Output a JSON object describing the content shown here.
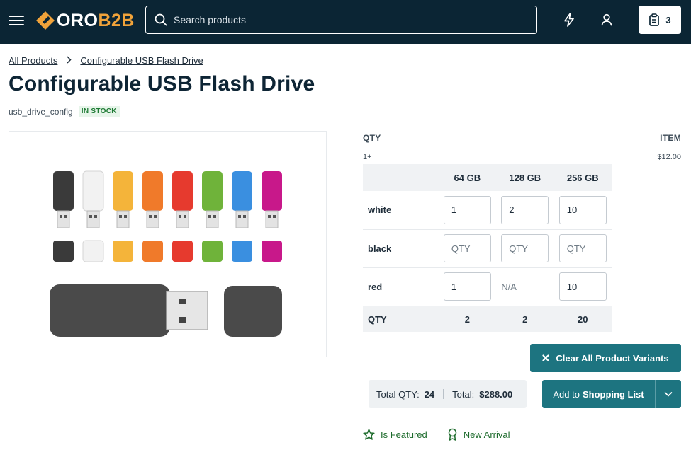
{
  "header": {
    "logo": {
      "part1": "ORO",
      "part2": "B2B"
    },
    "search_placeholder": "Search products",
    "cart_count": "3"
  },
  "breadcrumb": [
    "All Products",
    "Configurable USB Flash Drive"
  ],
  "product": {
    "title": "Configurable USB Flash Drive",
    "sku": "usb_drive_config",
    "stock": "IN STOCK"
  },
  "pricing": {
    "qty_header": "QTY",
    "item_header": "ITEM",
    "tier_qty": "1+",
    "tier_price": "$12.00"
  },
  "matrix": {
    "columns": [
      "64 GB",
      "128 GB",
      "256 GB"
    ],
    "rows": [
      {
        "label": "white",
        "cells": [
          {
            "value": "1"
          },
          {
            "value": "2"
          },
          {
            "value": "10"
          }
        ]
      },
      {
        "label": "black",
        "cells": [
          {
            "placeholder": "QTY"
          },
          {
            "placeholder": "QTY"
          },
          {
            "placeholder": "QTY"
          }
        ]
      },
      {
        "label": "red",
        "cells": [
          {
            "value": "1"
          },
          {
            "na": "N/A"
          },
          {
            "value": "10"
          }
        ]
      }
    ],
    "footer_label": "QTY",
    "footer_totals": [
      "2",
      "2",
      "20"
    ]
  },
  "actions": {
    "clear_label": "Clear All Product Variants",
    "total_qty_label": "Total QTY:",
    "total_qty_value": "24",
    "total_label": "Total:",
    "total_value": "$288.00",
    "add_prefix": "Add to",
    "add_bold": "Shopping List"
  },
  "labels": [
    "Is Featured",
    "New Arrival"
  ],
  "colors": {
    "header_bg": "#0b2534",
    "accent": "#1d7480",
    "logo_orange": "#f1a33a",
    "stock_green": "#1d7a33",
    "usb_caps": [
      "#3a3a3a",
      "#f2f2f2",
      "#f4b43a",
      "#f07a2a",
      "#e63a2e",
      "#6fb33a",
      "#3a8fe0",
      "#c8188a"
    ]
  }
}
